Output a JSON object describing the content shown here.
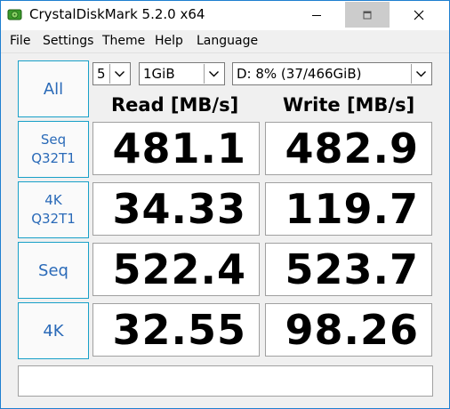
{
  "window": {
    "title": "CrystalDiskMark 5.2.0 x64",
    "controls": {
      "minimize": "—",
      "maximize": "▫",
      "close": "✕"
    }
  },
  "menu": [
    "File",
    "Settings",
    "Theme",
    "Help",
    "Language"
  ],
  "controls": {
    "all_label": "All",
    "count": "5",
    "size": "1GiB",
    "drive": "D: 8% (37/466GiB)"
  },
  "headers": {
    "read": "Read [MB/s]",
    "write": "Write [MB/s]"
  },
  "tests": [
    {
      "line1": "Seq",
      "line2": "Q32T1",
      "read": "481.1",
      "write": "482.9"
    },
    {
      "line1": "4K",
      "line2": "Q32T1",
      "read": "34.33",
      "write": "119.7"
    },
    {
      "line1": "Seq",
      "line2": "",
      "read": "522.4",
      "write": "523.7"
    },
    {
      "line1": "4K",
      "line2": "",
      "read": "32.55",
      "write": "98.26"
    }
  ],
  "status_text": "",
  "colors": {
    "accent": "#2a6ab8",
    "border": "#18a0c8"
  }
}
